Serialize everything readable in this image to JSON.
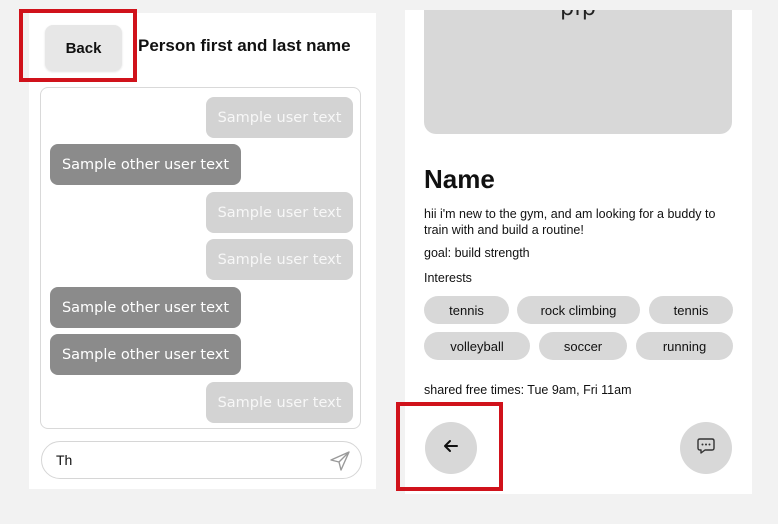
{
  "chat": {
    "back_label": "Back",
    "title": "Person first and last name",
    "messages": [
      {
        "sender": "self",
        "text": "Sample user text"
      },
      {
        "sender": "other",
        "text": "Sample other user text"
      },
      {
        "sender": "self",
        "text": "Sample user text"
      },
      {
        "sender": "self",
        "text": "Sample user text"
      },
      {
        "sender": "other",
        "text": "Sample other user text"
      },
      {
        "sender": "other",
        "text": "Sample other user text"
      },
      {
        "sender": "self",
        "text": "Sample user text"
      }
    ],
    "composer_value": "Th",
    "send_icon": "send-icon"
  },
  "profile": {
    "photo_label": "pfp",
    "name": "Name",
    "bio": "hii i'm new to the gym, and am looking for a buddy to train with and build a routine!",
    "goal": "goal: build strength",
    "interests_label": "Interests",
    "interests": [
      "tennis",
      "rock climbing",
      "tennis",
      "volleyball",
      "soccer",
      "running"
    ],
    "shared_times": "shared free times: Tue 9am, Fri 11am",
    "back_icon": "arrow-left-icon",
    "message_icon": "chat-bubble-icon"
  },
  "colors": {
    "highlight": "#d0121b",
    "self_bubble": "#d3d3d3",
    "other_bubble": "#8b8b8b",
    "chip": "#d8d8d8"
  }
}
